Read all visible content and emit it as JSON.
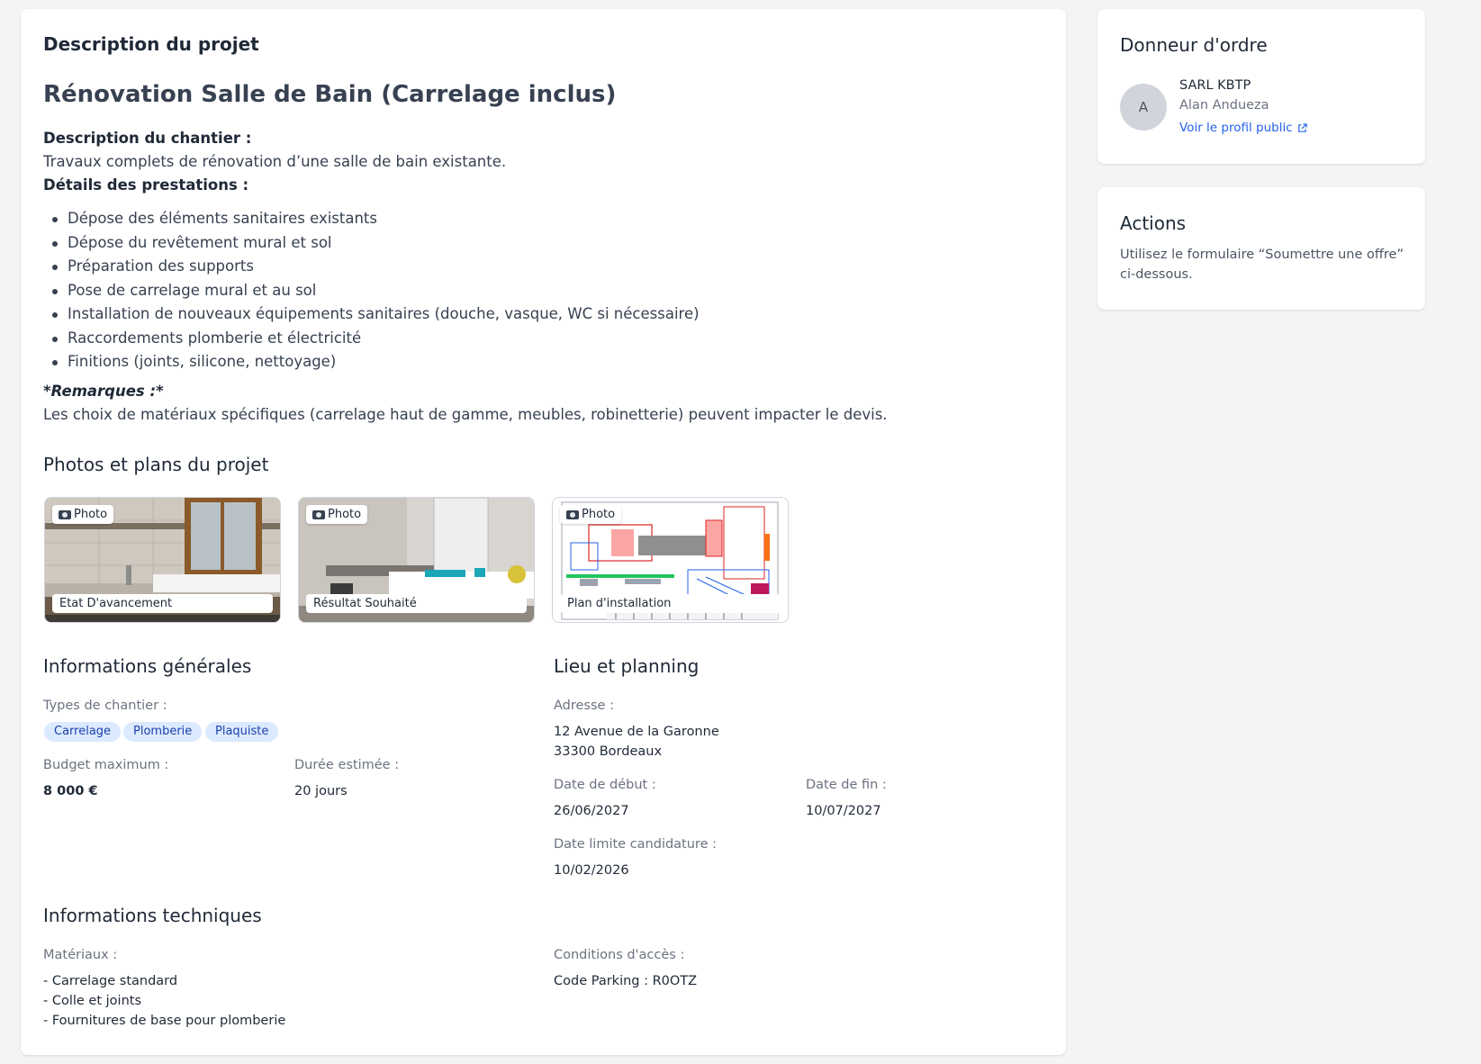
{
  "project": {
    "section_title": "Description du projet",
    "title": "Rénovation Salle de Bain (Carrelage inclus)",
    "chantier_label": "Description du chantier :",
    "chantier_text": "Travaux complets de rénovation d’une salle de bain existante.",
    "prestations_label": "Détails des prestations :",
    "prestations": [
      "Dépose des éléments sanitaires existants",
      "Dépose du revêtement mural et sol",
      "Préparation des supports",
      "Pose de carrelage mural et au sol",
      "Installation de nouveaux équipements sanitaires (douche, vasque, WC si nécessaire)",
      "Raccordements plomberie et électricité",
      "Finitions (joints, silicone, nettoyage)"
    ],
    "remarques_label": "*Remarques :*",
    "remarques_text": "Les choix de matériaux spécifiques (carrelage haut de gamme, meubles, robinetterie) peuvent impacter le devis."
  },
  "photos": {
    "title": "Photos et plans du projet",
    "items": [
      {
        "badge": "Photo",
        "caption": "Etat D'avancement"
      },
      {
        "badge": "Photo",
        "caption": "Résultat Souhaité"
      },
      {
        "badge": "Photo",
        "caption": "Plan d'installation"
      }
    ]
  },
  "general": {
    "title": "Informations générales",
    "types_label": "Types de chantier :",
    "types": [
      "Carrelage",
      "Plomberie",
      "Plaquiste"
    ],
    "budget_label": "Budget maximum :",
    "budget_value": "8 000 €",
    "duree_label": "Durée estimée :",
    "duree_value": "20 jours"
  },
  "lieu": {
    "title": "Lieu et planning",
    "adresse_label": "Adresse :",
    "adresse_line1": "12 Avenue de la Garonne",
    "adresse_line2": "33300 Bordeaux",
    "debut_label": "Date de début :",
    "debut_value": "26/06/2027",
    "fin_label": "Date de fin :",
    "fin_value": "10/07/2027",
    "limite_label": "Date limite candidature :",
    "limite_value": "10/02/2026"
  },
  "tech": {
    "title": "Informations techniques",
    "materiaux_label": "Matériaux :",
    "materiaux": [
      "- Carrelage standard",
      "- Colle et joints",
      "- Fournitures de base pour plomberie"
    ],
    "acces_label": "Conditions d'accès :",
    "acces_value": "Code Parking : R0OTZ"
  },
  "donneur": {
    "title": "Donneur d'ordre",
    "avatar_letter": "A",
    "company": "SARL KBTP",
    "person": "Alan Andueza",
    "profile_link": "Voir le profil public"
  },
  "actions": {
    "title": "Actions",
    "text_line1": "Utilisez le formulaire “Soumettre une offre”",
    "text_line2": "ci-dessous."
  },
  "colors": {
    "accent": "#2563eb",
    "tag_bg": "#dbeafe",
    "tag_text": "#1e40af"
  }
}
